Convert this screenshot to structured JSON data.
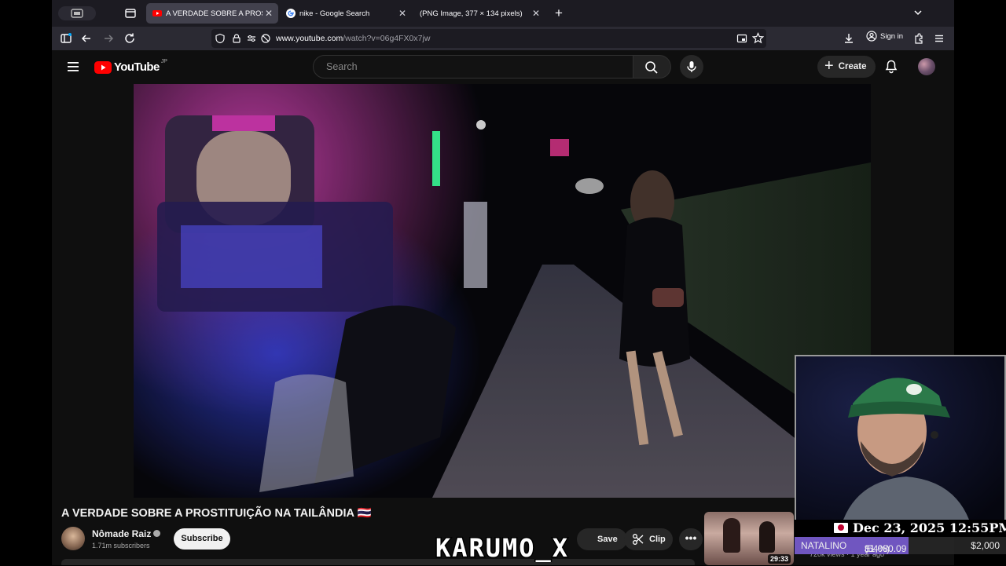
{
  "browser": {
    "tabs": [
      {
        "title": "A VERDADE SOBRE A PROSTITUIÇÃO NA TAILÂNDIA",
        "favicon": "youtube-icon",
        "active": true
      },
      {
        "title": "nike - Google Search",
        "favicon": "google-icon",
        "active": false
      },
      {
        "title": "(PNG Image, 377 × 134 pixels)",
        "favicon": "none",
        "active": false
      }
    ],
    "url_domain": "www.youtube.com",
    "url_path": "/watch?v=06g4FX0x7jw",
    "sign_in": "Sign in"
  },
  "youtube": {
    "logo_text": "YouTube",
    "region": "JP",
    "search_placeholder": "Search",
    "create_label": "Create"
  },
  "video": {
    "title": "A VERDADE SOBRE A PROSTITUIÇÃO NA TAILÂNDIA 🇹🇭",
    "channel_name": "Nômade Raiz",
    "subscribers": "1.71m subscribers",
    "subscribe_label": "Subscribe",
    "save_label": "Save",
    "clip_label": "Clip",
    "more_label": "•••"
  },
  "recommendation": {
    "duration": "29:33",
    "meta": "720k views · 1 year ago"
  },
  "stream_overlay": {
    "datetime": "Dec 23, 2025 12:55PM",
    "market_name": "NATALINO",
    "market_value": "$1,080.09",
    "market_percent": "(54%)",
    "market_target": "$2,000",
    "progress": 0.54,
    "watermark": "KARUMO_X"
  },
  "colors": {
    "youtube_red": "#ff0000",
    "progress_purple": "#7e5fdc",
    "browser_tab_active": "#42414d"
  }
}
